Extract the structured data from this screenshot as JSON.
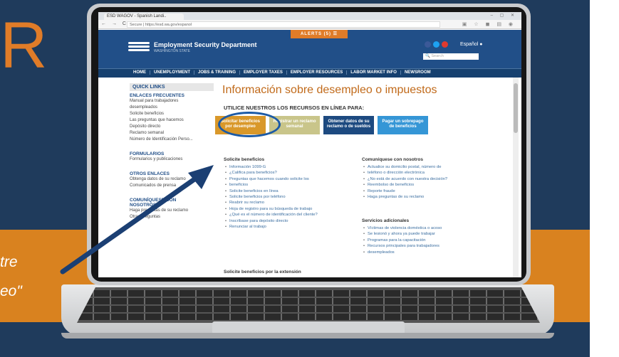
{
  "background": {
    "big_letter": "R",
    "quote_line1": "tre",
    "quote_line2": "eo\""
  },
  "browser": {
    "tab_title": "ESD WAGOV - Spanish Landi..",
    "window_controls": "– ▢ ✕",
    "nav_buttons": "← → C ⌂",
    "url": "Secure | https://esd.wa.gov/espanol"
  },
  "site": {
    "alerts": "ALERTS (5) ☰",
    "name": "Employment Security Department",
    "subtitle": "WASHINGTON STATE",
    "espanol": "Español",
    "search_placeholder": "Search",
    "nav": [
      "HOME",
      "UNEMPLOYMENT",
      "JOBS & TRAINING",
      "EMPLOYER TAXES",
      "EMPLOYER RESOURCES",
      "LABOR MARKET INFO",
      "NEWSROOM"
    ]
  },
  "left": {
    "quick_links": "QUICK LINKS",
    "enlaces_head": "ENLACES FRECUENTES",
    "enlaces": [
      "Manual para trabajadores",
      "desempleados",
      "Solicite beneficios",
      "Las preguntas que hacemos",
      "Depósito directo",
      "Reclamo semanal",
      "Número de Identificación Perso..."
    ],
    "formularios_head": "FORMULARIOS",
    "formularios": [
      "Formularios y publicaciones"
    ],
    "otros_head": "OTROS ENLACES",
    "otros": [
      "Obtenga datos de su reclamo",
      "Comunicados de prensa"
    ],
    "comuniquese_head1": "COMUNÍQUESE CON",
    "comuniquese_head2": "NOSOTROS",
    "comuniquese": [
      "Haga preguntas de su reclamo",
      "Otras preguntas"
    ]
  },
  "main": {
    "title": "Información sobre desempleo o impuestos",
    "use_online": "UTILICE NUESTROS LOS RECURSOS EN LÍNEA PARA:",
    "tiles": [
      {
        "line1": "Solicitar beneficios",
        "line2": "por desempleo",
        "color": "#d9982a"
      },
      {
        "line1": "Registrar un reclamo",
        "line2": "semanal",
        "color": "#c9c58a"
      },
      {
        "line1": "Obtener datos de su",
        "line2": "reclamo o de sueldos",
        "color": "#1d4a80"
      },
      {
        "line1": "Pagar un sobrepago",
        "line2": "de beneficios",
        "color": "#3596d6"
      }
    ],
    "col1_head": "Solicite beneficios",
    "col1": [
      "Información 1099-G",
      "¿Califica para beneficios?",
      "Preguntas que hacemos cuando solicite los",
      "beneficios",
      "Solicite beneficios en línea",
      "Solicite beneficios por teléfono",
      "Reabrir su reclamo",
      "Hoja de registro para su búsqueda de trabajo",
      "¿Qué es el número de identificación del cliente?",
      "Inscríbase para depósito directo",
      "Renunciar al trabajo"
    ],
    "col1b_head": "Solicite beneficios por la extensión",
    "col2_head": "Comuníquese con nosotros",
    "col2": [
      "Actualice su domicilio postal, número de",
      "teléfono o dirección electrónica",
      "¿No está de acuerdo con nuestra decisión?",
      "Reembolso de beneficios",
      "Reporte fraude",
      "Haga preguntas de su reclamo"
    ],
    "col2b_head": "Servicios adicionales",
    "col2b": [
      "Víctimas de violencia doméstica o acoso",
      "Se lesionó y ahora ya puede trabajar",
      "Programas para la capacitación",
      "Recursos principales para trabajadores",
      "desempleados"
    ]
  },
  "colors": {
    "accent_orange": "#e07c28",
    "brand_blue": "#214f88",
    "background_navy": "#1f3b5c",
    "callout_blue": "#1b5aa6"
  }
}
